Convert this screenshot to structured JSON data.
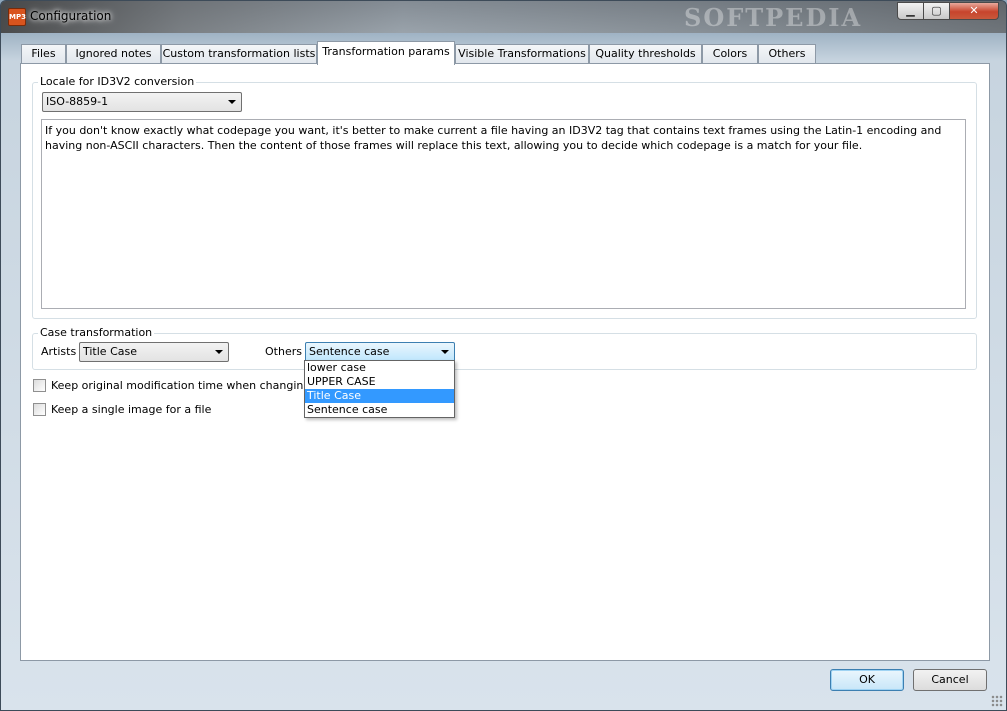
{
  "window": {
    "title": "Configuration",
    "watermark": "SOFTPEDIA",
    "app_icon_text": "MP3"
  },
  "controls": {
    "minimize": "▁",
    "maximize": "▢",
    "close": "✕"
  },
  "tabs": [
    {
      "label": "Files"
    },
    {
      "label": "Ignored notes"
    },
    {
      "label": "Custom transformation lists"
    },
    {
      "label": "Transformation params",
      "active": true
    },
    {
      "label": "Visible Transformations"
    },
    {
      "label": "Quality thresholds"
    },
    {
      "label": "Colors"
    },
    {
      "label": "Others"
    }
  ],
  "locale_group": {
    "label": "Locale for ID3V2 conversion",
    "selected": "ISO-8859-1",
    "info_text": "If you don't know exactly what codepage you want, it's better to make current a file having an ID3V2 tag that contains text frames using the Latin-1 encoding and having non-ASCII characters. Then the content of those frames will replace this text, allowing you to decide which codepage is a match for your file."
  },
  "case_group": {
    "label": "Case transformation",
    "artists_label": "Artists",
    "artists_value": "Title Case",
    "others_label": "Others",
    "others_value": "Sentence case",
    "options": [
      "lower case",
      "UPPER CASE",
      "Title Case",
      "Sentence case"
    ],
    "highlighted_option": "Title Case"
  },
  "checkboxes": [
    {
      "label": "Keep original modification time when changing a file",
      "checked": false
    },
    {
      "label": "Keep a single image for a file",
      "checked": false
    }
  ],
  "buttons": {
    "ok": "OK",
    "cancel": "Cancel"
  }
}
